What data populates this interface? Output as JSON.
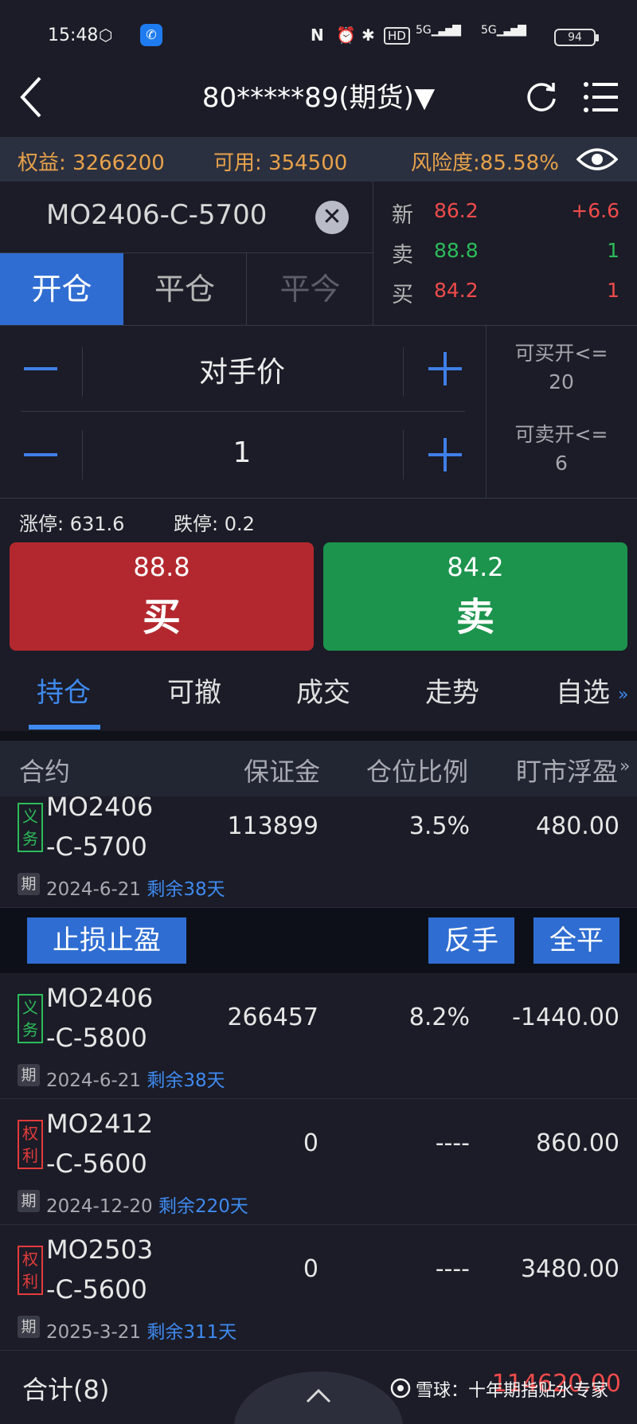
{
  "status_bar": {
    "time": "15:48",
    "icons": [
      "hexagon-icon",
      "phone-app-icon",
      "nfc-icon",
      "alarm-icon",
      "bluetooth-icon",
      "hd-icon",
      "signal-5g-icon",
      "signal-5g-icon"
    ],
    "hd_label": "HD",
    "net1": "5G",
    "net2": "5G",
    "battery": "94"
  },
  "header": {
    "title": "80*****89(期货)▼"
  },
  "account": {
    "equity_label": "权益",
    "equity_value": "3266200",
    "available_label": "可用",
    "available_value": "354500",
    "risk_label": "风险度",
    "risk_value": "85.58%"
  },
  "contract": {
    "code": "MO2406-C-5700",
    "clear": "✕"
  },
  "open_close_tabs": {
    "open": "开仓",
    "close": "平仓",
    "close_today": "平今"
  },
  "quote": {
    "last_label": "新",
    "last_price": "86.2",
    "last_change": "+6.6",
    "ask_label": "卖",
    "ask_price": "88.8",
    "ask_vol": "1",
    "bid_label": "买",
    "bid_price": "84.2",
    "bid_vol": "1"
  },
  "order": {
    "price_type": "对手价",
    "quantity": "1",
    "max_buy_open_label": "可买开<=",
    "max_buy_open": "20",
    "max_sell_open_label": "可卖开<=",
    "max_sell_open": "6",
    "limit_up_label": "涨停",
    "limit_up": "631.6",
    "limit_down_label": "跌停",
    "limit_down": "0.2"
  },
  "buy_button": {
    "price": "88.8",
    "label": "买"
  },
  "sell_button": {
    "price": "84.2",
    "label": "卖"
  },
  "tabs": [
    "持仓",
    "可撤",
    "成交",
    "走势",
    "自选"
  ],
  "active_tab": "持仓",
  "table": {
    "headers": [
      "合约",
      "保证金",
      "仓位比例",
      "盯市浮盈"
    ],
    "rows": [
      {
        "tag": [
          "义",
          "务"
        ],
        "type": "obligation",
        "code1": "MO2406",
        "code2": "-C-5700",
        "margin": "113899",
        "ratio": "3.5%",
        "pnl": "480.00",
        "pnl_color": "red",
        "qi": "期",
        "expiry": "2024-6-21",
        "remain": "剩余38天"
      },
      {
        "tag": [
          "义",
          "务"
        ],
        "type": "obligation",
        "code1": "MO2406",
        "code2": "-C-5800",
        "margin": "266457",
        "ratio": "8.2%",
        "pnl": "-1440.00",
        "pnl_color": "green",
        "qi": "期",
        "expiry": "2024-6-21",
        "remain": "剩余38天"
      },
      {
        "tag": [
          "权",
          "利"
        ],
        "type": "right",
        "code1": "MO2412",
        "code2": "-C-5600",
        "margin": "0",
        "ratio": "----",
        "pnl": "860.00",
        "pnl_color": "red",
        "qi": "期",
        "expiry": "2024-12-20",
        "remain": "剩余220天"
      },
      {
        "tag": [
          "权",
          "利"
        ],
        "type": "right",
        "code1": "MO2503",
        "code2": "-C-5600",
        "margin": "0",
        "ratio": "----",
        "pnl": "3480.00",
        "pnl_color": "red",
        "qi": "期",
        "expiry": "2025-3-21",
        "remain": "剩余311天"
      }
    ]
  },
  "row_actions": {
    "stop": "止损止盈",
    "reverse": "反手",
    "close_all": "全平"
  },
  "footer": {
    "total_label": "合计(8)",
    "total_value": "114620.00",
    "watermark": "雪球：十年期指贴水专家"
  },
  "colors": {
    "accent": "#2f6dd2",
    "up": "#f04b4b",
    "down": "#2dbb5a",
    "equity": "#e8a24a"
  }
}
